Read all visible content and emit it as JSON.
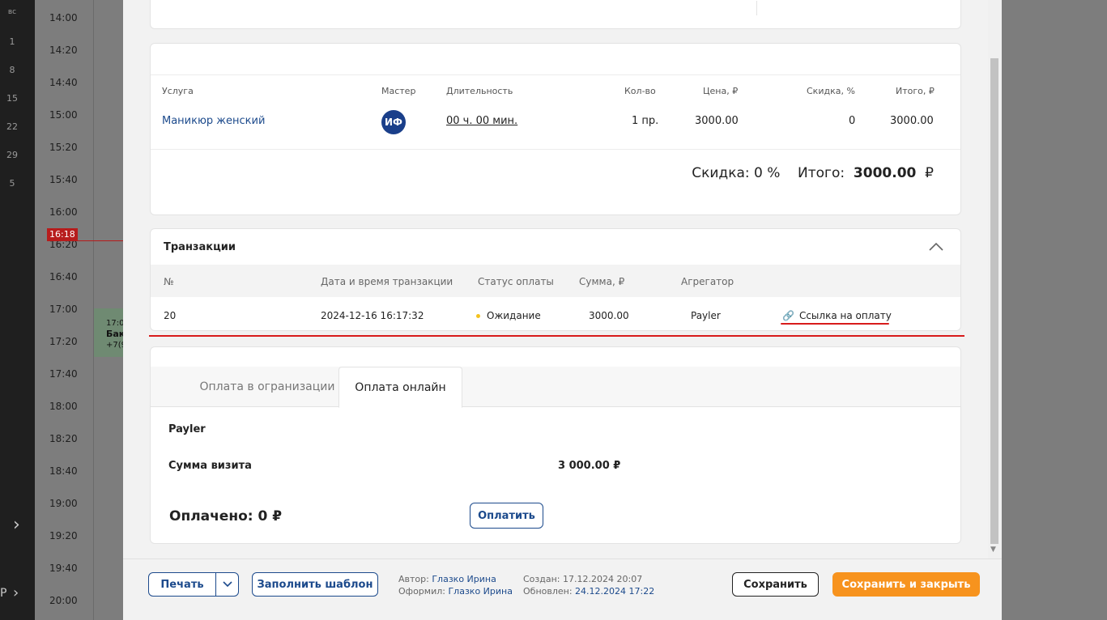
{
  "sidebar": {
    "days": [
      "вс",
      "1",
      "8",
      "15",
      "22",
      "29",
      "5"
    ],
    "bottom_label": "P"
  },
  "calendar": {
    "times": [
      "14:00",
      "14:20",
      "14:40",
      "15:00",
      "15:20",
      "15:40",
      "16:00",
      "16:20",
      "16:40",
      "17:00",
      "17:20",
      "17:40",
      "18:00",
      "18:20",
      "18:40",
      "19:00",
      "19:20",
      "19:40",
      "20:00"
    ],
    "now_label": "16:18",
    "event": {
      "time": "17:0",
      "name": "Бак",
      "phone": "+7(9"
    }
  },
  "services": {
    "headers": {
      "service": "Услуга",
      "master": "Мастер",
      "duration": "Длительность",
      "qty": "Кол-во",
      "price": "Цена, ₽",
      "discount": "Скидка, %",
      "total": "Итого, ₽"
    },
    "row": {
      "service": "Маникюр женский",
      "master_initials": "ИФ",
      "duration": "00 ч. 00 мин.",
      "qty": "1 пр.",
      "price": "3000.00",
      "discount": "0",
      "total": "3000.00"
    },
    "summary": {
      "discount_label": "Скидка: 0 %",
      "total_label": "Итого:",
      "total_value": "3000.00",
      "currency": "₽"
    }
  },
  "transactions": {
    "title": "Транзакции",
    "headers": {
      "number": "№",
      "datetime": "Дата и время транзакции",
      "status": "Статус оплаты",
      "amount": "Сумма, ₽",
      "aggregator": "Агрегатор"
    },
    "row": {
      "number": "20",
      "datetime": "2024-12-16 16:17:32",
      "status": "Ожидание",
      "amount": "3000.00",
      "aggregator": "Payler",
      "link": "Ссылка на оплату"
    },
    "status_color": "#f4c21e"
  },
  "payment": {
    "tabs": [
      "Оплата в огранизации",
      "Оплата онлайн"
    ],
    "provider": "Payler",
    "visit_sum_label": "Сумма визита",
    "visit_sum_value": "3 000.00 ₽",
    "paid_label": "Оплачено: 0 ₽",
    "pay_button": "Оплатить"
  },
  "footer": {
    "print": "Печать",
    "fill_template": "Заполнить шаблон",
    "author_label": "Автор:",
    "author": "Глазко Ирина",
    "issued_label": "Оформил:",
    "issued": "Глазко Ирина",
    "created_label": "Создан:",
    "created": "17.12.2024 20:07",
    "updated_label": "Обновлен:",
    "updated": "24.12.2024 17:22",
    "save": "Сохранить",
    "save_close": "Сохранить и закрыть"
  },
  "colors": {
    "accent": "#1c4a8c",
    "primary_action": "#f7931e",
    "highlight": "#d81b1b"
  }
}
